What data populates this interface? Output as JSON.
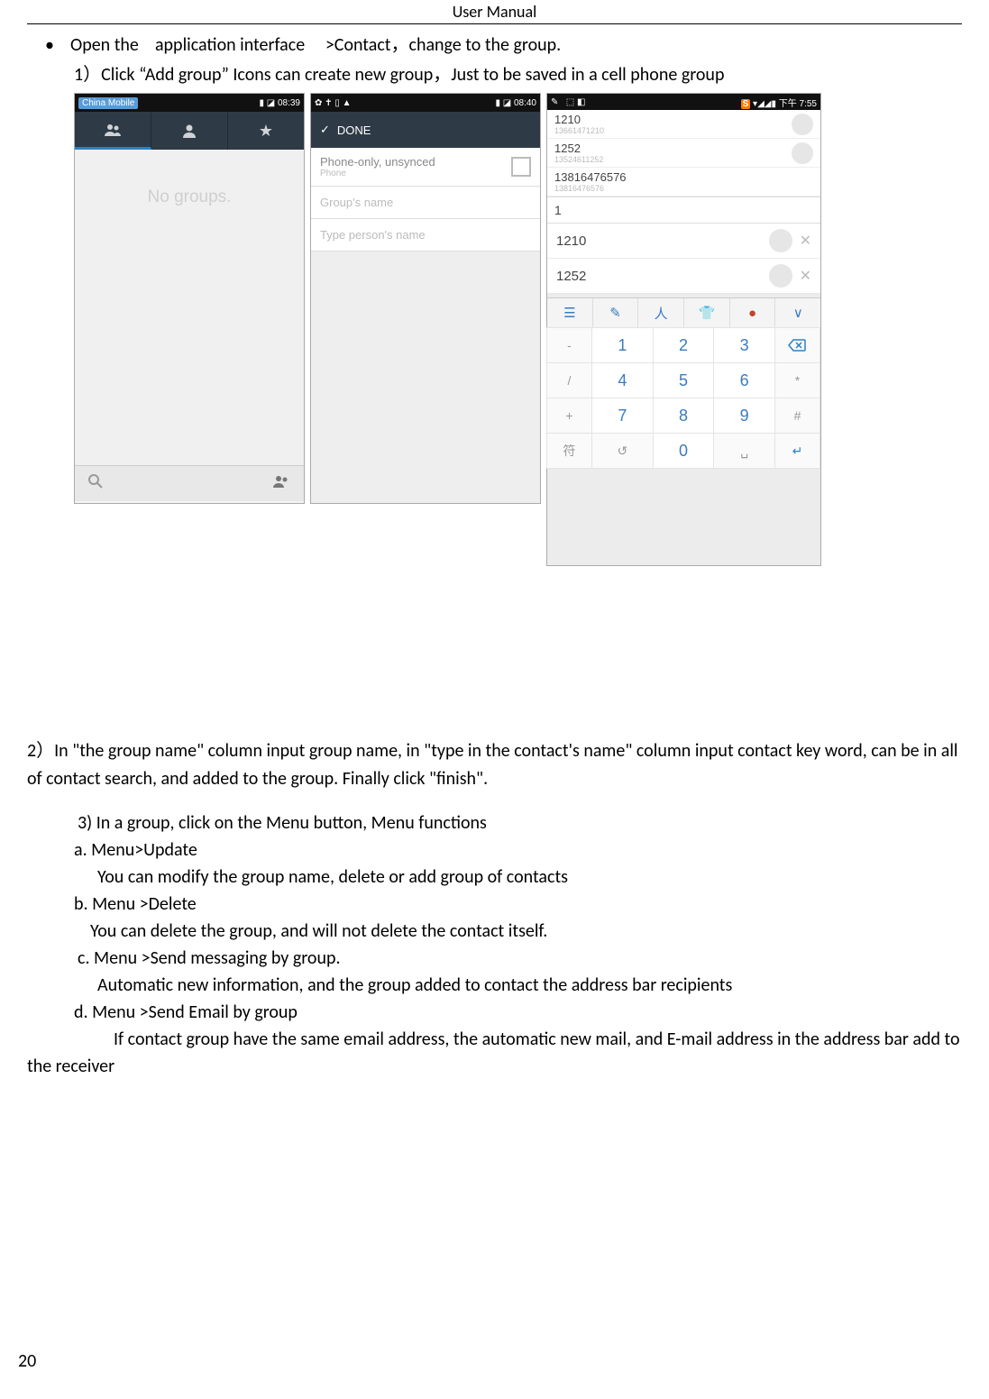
{
  "header": {
    "title": "User    Manual"
  },
  "bullet": {
    "text_a": "Open the",
    "text_b": "application interface",
    "text_c": ">Contact，change to the group."
  },
  "step1": {
    "prefix": "1）Click",
    "quoted": "“Add group”",
    "mid": "Icons can create new group，Just to be",
    "tail": "saved in a cell phone group"
  },
  "phone1": {
    "carrier": "China Mobile",
    "time": "08:39",
    "star": "★",
    "body": "No groups.",
    "search_icon": "search-icon",
    "addgroup_icon": "addgroup-icon"
  },
  "phone2": {
    "status_icons": "✿ ✝ ▯ ▲",
    "time": "08:40",
    "done_check": "✓",
    "done_label": "DONE",
    "row_label": "Phone-only, unsynced",
    "row_sub": "Phone",
    "input1": "Group's name",
    "input2": "Type person's name"
  },
  "phone3": {
    "status_left_s": "S",
    "status_time": "下午 7:55",
    "sug1": {
      "name": "1210",
      "sub": "13661471210"
    },
    "sug2": {
      "name": "1252",
      "sub": "13524611252"
    },
    "sug3": {
      "name": "13816476576",
      "sub": "13816476576"
    },
    "search_value": "1",
    "chip1": "1210",
    "chip2": "1252",
    "toolbar": {
      "a": "☰",
      "b": "✎",
      "c": "人",
      "d": "👕",
      "e": "●",
      "f": "∨"
    },
    "keys": {
      "r1": [
        "-",
        "1",
        "2",
        "3",
        "⌫"
      ],
      "r2": [
        "/",
        "4",
        "5",
        "6",
        "*"
      ],
      "r3": [
        "+",
        "7",
        "8",
        "9",
        "#"
      ],
      "r4": [
        "符",
        "↺",
        "0",
        "␣",
        "↵"
      ]
    }
  },
  "step2": {
    "text": "2）In \"the group name\" column input group name, in \"type in the contact's name\" column input contact key word, can be in all of contact search, and added to the group. Finally click \"finish\"."
  },
  "step3": {
    "intro": "3) In a group, click on the Menu button,   Menu functions",
    "a_label": "a.    Menu>Update",
    "a_body": "You can modify the group name, delete or add group of contacts",
    "b_label": "b.    Menu >Delete",
    "b_body": "You can delete the group, and will not delete the contact itself.",
    "c_label": "c.    Menu >Send messaging by group.",
    "c_body": "Automatic new information, and the group added to contact the address bar recipients",
    "d_label": "d.    Menu >Send Email by group",
    "d_body": "If contact group have the same email address, the automatic new mail, and E-mail address in the address bar add to the receiver"
  },
  "page_number": "20"
}
